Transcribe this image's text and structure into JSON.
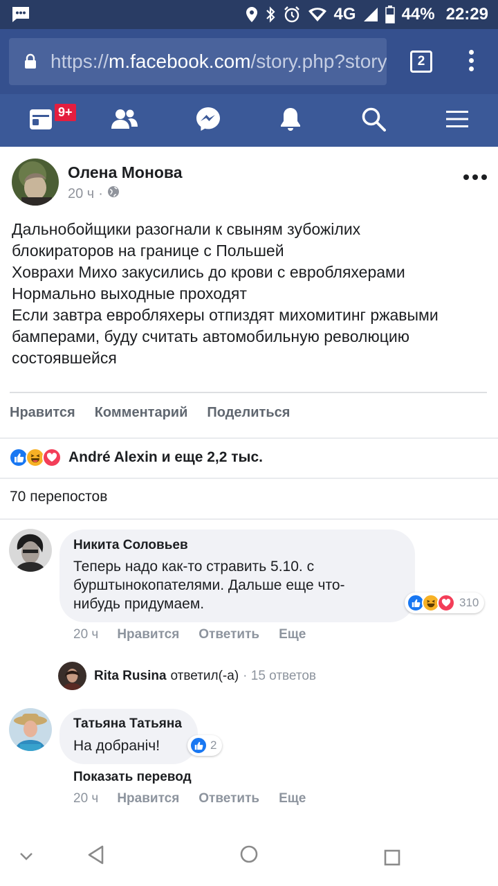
{
  "status_bar": {
    "battery": "44%",
    "time": "22:29",
    "network": "4G",
    "icons": [
      "message-icon",
      "location-icon",
      "bluetooth-icon",
      "alarm-icon",
      "wifi-icon",
      "signal-icon",
      "battery-icon"
    ]
  },
  "browser": {
    "url_scheme": "https://",
    "url_domain": "m.facebook.com",
    "url_path": "/story.php?story_fbid",
    "tab_count": "2"
  },
  "fb_nav": {
    "badge": "9+",
    "items": [
      "news-feed-icon",
      "friends-icon",
      "messenger-icon",
      "notifications-icon",
      "search-icon",
      "menu-icon"
    ]
  },
  "post": {
    "author": "Олена Монова",
    "time": "20 ч",
    "separator": "·",
    "lines": [
      "Дальнобойщики разогнали к свыням зубожілих",
      "блокираторов на границе с Польшей",
      "Ховрахи Михо закусились до крови с евробляхерами",
      "Нормально выходные проходят",
      "Если завтра евробляхеры отпиздят михомитинг ржавыми",
      "бамперами, буду считать автомобильную революцию",
      "состоявшейся"
    ],
    "actions": {
      "like": "Нравится",
      "comment": "Комментарий",
      "share": "Поделиться"
    },
    "reactions_text": "André Alexin и еще 2,2 тыс.",
    "shares_text": "70 перепостов"
  },
  "comments": [
    {
      "author": "Никита Соловьев",
      "lines": [
        "Теперь надо как-то стравить 5.10. с",
        "бурштынокопателями. Дальше еще что-",
        "нибудь придумаем."
      ],
      "reaction_count": "310",
      "time": "20 ч",
      "like": "Нравится",
      "reply": "Ответить",
      "more": "Еще",
      "reply_preview": {
        "author": "Rita Rusina",
        "text": "ответил(-а)",
        "count": "· 15 ответов"
      }
    },
    {
      "author": "Татьяна Татьяна",
      "lines": [
        "На добраніч!"
      ],
      "reaction_count": "2",
      "show_translation": "Показать перевод",
      "time": "20 ч",
      "like": "Нравится",
      "reply": "Ответить",
      "more": "Еще"
    }
  ],
  "colors": {
    "status_bar": "#293c64",
    "url_bar": "#35508e",
    "fb_blue": "#3b5998",
    "like_blue": "#1877f2",
    "love_red": "#f33e58",
    "haha_yellow": "#f7b125"
  }
}
